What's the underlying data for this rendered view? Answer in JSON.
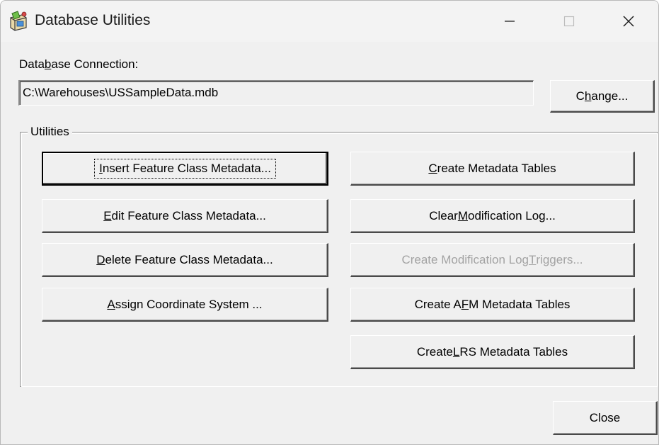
{
  "window": {
    "title": "Database Utilities",
    "controls": {
      "minimize": "minimize",
      "maximize": "maximize",
      "close": "close"
    }
  },
  "connection": {
    "label_parts": [
      "Data",
      "b",
      "ase Connection:"
    ],
    "path": "C:\\Warehouses\\USSampleData.mdb",
    "change_parts": [
      "C",
      "h",
      "ange..."
    ]
  },
  "utilities": {
    "legend": "Utilities",
    "left_buttons": [
      {
        "pre": "",
        "u": "I",
        "post": "nsert Feature Class Metadata...",
        "default": true
      },
      {
        "pre": "",
        "u": "E",
        "post": "dit Feature Class Metadata..."
      },
      {
        "pre": "",
        "u": "D",
        "post": "elete Feature Class Metadata..."
      },
      {
        "pre": "",
        "u": "A",
        "post": "ssign Coordinate System ..."
      }
    ],
    "right_buttons": [
      {
        "pre": "",
        "u": "C",
        "post": "reate Metadata Tables"
      },
      {
        "pre": "Clear ",
        "u": "M",
        "post": "odification Log..."
      },
      {
        "pre": "Create Modification Log ",
        "u": "T",
        "post": "riggers...",
        "disabled": true
      },
      {
        "pre": "Create A",
        "u": "F",
        "post": "M Metadata Tables"
      },
      {
        "pre": "Create ",
        "u": "L",
        "post": "RS Metadata Tables"
      }
    ]
  },
  "footer": {
    "close_label": "Close"
  },
  "colors": {
    "face": "#f0f0f0",
    "disabled_text": "#a3a3a3",
    "shadow": "#4a4a4a"
  }
}
